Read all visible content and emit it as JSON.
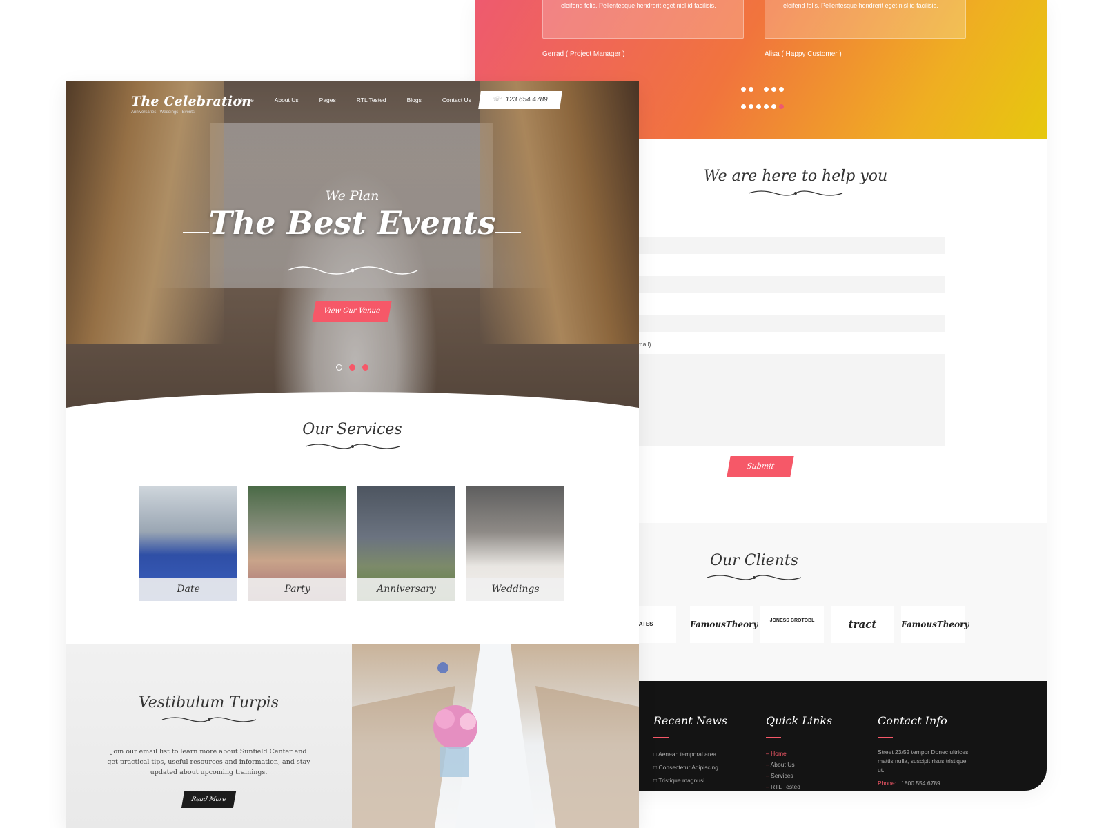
{
  "testimonials": {
    "items": [
      {
        "quote": "eleifend felis. Pellentesque hendrerit eget nisl id facilisis.",
        "author": "Gerrad ( Project Manager )"
      },
      {
        "quote": "eleifend felis. Pellentesque hendrerit eget nisl id facilisis.",
        "author": "Alisa ( Happy Customer )"
      }
    ]
  },
  "contact": {
    "title": "We are here to help you",
    "message_label": "mail)",
    "submit_label": "Submit"
  },
  "clients": {
    "title": "Our Clients",
    "logos": [
      "TATES",
      "FamousTheory",
      "JONESS BROTOBL",
      "tract",
      "FamousTheory"
    ]
  },
  "footer": {
    "recent_news": {
      "title": "Recent News",
      "items": [
        "Aenean temporal area",
        "Consectetur Adipiscing",
        "Tristique magnusi"
      ]
    },
    "quick_links": {
      "title": "Quick Links",
      "items": [
        "Home",
        "About Us",
        "Services",
        "RTL Tested"
      ]
    },
    "contact_info": {
      "title": "Contact Info",
      "address": "Street 23/52 tempor Donec ultrices mattis nulla, suscipit risus tristique ut.",
      "phone_label": "Phone:",
      "phone": "1800 554 6789"
    }
  },
  "site": {
    "brand": "The Celebration",
    "tagline": "Anniversaries · Weddings · Events",
    "nav": [
      "Home",
      "About Us",
      "Pages",
      "RTL Tested",
      "Blogs",
      "Contact Us"
    ],
    "phone": "123 654 4789"
  },
  "hero": {
    "kicker": "We Plan",
    "headline": "The Best Events",
    "cta": "View Our Venue",
    "active_dot": 1
  },
  "services": {
    "title": "Our Services",
    "items": [
      "Date",
      "Party",
      "Anniversary",
      "Weddings"
    ]
  },
  "promo": {
    "title": "Vestibulum Turpis",
    "text": "Join our email list to learn more about Sunfield Center and get practical tips, useful resources and information, and stay updated about upcoming trainings.",
    "cta": "Read More"
  },
  "colors": {
    "accent": "#f65868",
    "footer_bg": "#141414",
    "dark_button": "#1c1c1c"
  }
}
